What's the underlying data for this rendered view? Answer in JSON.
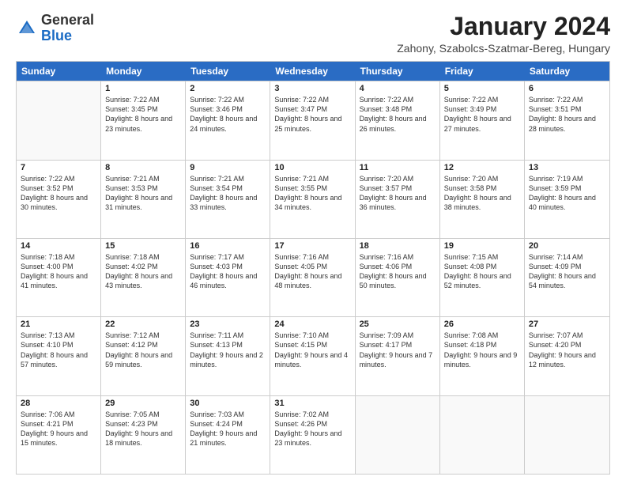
{
  "header": {
    "logo_general": "General",
    "logo_blue": "Blue",
    "month_title": "January 2024",
    "location": "Zahony, Szabolcs-Szatmar-Bereg, Hungary"
  },
  "weekdays": [
    "Sunday",
    "Monday",
    "Tuesday",
    "Wednesday",
    "Thursday",
    "Friday",
    "Saturday"
  ],
  "weeks": [
    [
      {
        "day": "",
        "sunrise": "",
        "sunset": "",
        "daylight": ""
      },
      {
        "day": "1",
        "sunrise": "Sunrise: 7:22 AM",
        "sunset": "Sunset: 3:45 PM",
        "daylight": "Daylight: 8 hours and 23 minutes."
      },
      {
        "day": "2",
        "sunrise": "Sunrise: 7:22 AM",
        "sunset": "Sunset: 3:46 PM",
        "daylight": "Daylight: 8 hours and 24 minutes."
      },
      {
        "day": "3",
        "sunrise": "Sunrise: 7:22 AM",
        "sunset": "Sunset: 3:47 PM",
        "daylight": "Daylight: 8 hours and 25 minutes."
      },
      {
        "day": "4",
        "sunrise": "Sunrise: 7:22 AM",
        "sunset": "Sunset: 3:48 PM",
        "daylight": "Daylight: 8 hours and 26 minutes."
      },
      {
        "day": "5",
        "sunrise": "Sunrise: 7:22 AM",
        "sunset": "Sunset: 3:49 PM",
        "daylight": "Daylight: 8 hours and 27 minutes."
      },
      {
        "day": "6",
        "sunrise": "Sunrise: 7:22 AM",
        "sunset": "Sunset: 3:51 PM",
        "daylight": "Daylight: 8 hours and 28 minutes."
      }
    ],
    [
      {
        "day": "7",
        "sunrise": "Sunrise: 7:22 AM",
        "sunset": "Sunset: 3:52 PM",
        "daylight": "Daylight: 8 hours and 30 minutes."
      },
      {
        "day": "8",
        "sunrise": "Sunrise: 7:21 AM",
        "sunset": "Sunset: 3:53 PM",
        "daylight": "Daylight: 8 hours and 31 minutes."
      },
      {
        "day": "9",
        "sunrise": "Sunrise: 7:21 AM",
        "sunset": "Sunset: 3:54 PM",
        "daylight": "Daylight: 8 hours and 33 minutes."
      },
      {
        "day": "10",
        "sunrise": "Sunrise: 7:21 AM",
        "sunset": "Sunset: 3:55 PM",
        "daylight": "Daylight: 8 hours and 34 minutes."
      },
      {
        "day": "11",
        "sunrise": "Sunrise: 7:20 AM",
        "sunset": "Sunset: 3:57 PM",
        "daylight": "Daylight: 8 hours and 36 minutes."
      },
      {
        "day": "12",
        "sunrise": "Sunrise: 7:20 AM",
        "sunset": "Sunset: 3:58 PM",
        "daylight": "Daylight: 8 hours and 38 minutes."
      },
      {
        "day": "13",
        "sunrise": "Sunrise: 7:19 AM",
        "sunset": "Sunset: 3:59 PM",
        "daylight": "Daylight: 8 hours and 40 minutes."
      }
    ],
    [
      {
        "day": "14",
        "sunrise": "Sunrise: 7:18 AM",
        "sunset": "Sunset: 4:00 PM",
        "daylight": "Daylight: 8 hours and 41 minutes."
      },
      {
        "day": "15",
        "sunrise": "Sunrise: 7:18 AM",
        "sunset": "Sunset: 4:02 PM",
        "daylight": "Daylight: 8 hours and 43 minutes."
      },
      {
        "day": "16",
        "sunrise": "Sunrise: 7:17 AM",
        "sunset": "Sunset: 4:03 PM",
        "daylight": "Daylight: 8 hours and 46 minutes."
      },
      {
        "day": "17",
        "sunrise": "Sunrise: 7:16 AM",
        "sunset": "Sunset: 4:05 PM",
        "daylight": "Daylight: 8 hours and 48 minutes."
      },
      {
        "day": "18",
        "sunrise": "Sunrise: 7:16 AM",
        "sunset": "Sunset: 4:06 PM",
        "daylight": "Daylight: 8 hours and 50 minutes."
      },
      {
        "day": "19",
        "sunrise": "Sunrise: 7:15 AM",
        "sunset": "Sunset: 4:08 PM",
        "daylight": "Daylight: 8 hours and 52 minutes."
      },
      {
        "day": "20",
        "sunrise": "Sunrise: 7:14 AM",
        "sunset": "Sunset: 4:09 PM",
        "daylight": "Daylight: 8 hours and 54 minutes."
      }
    ],
    [
      {
        "day": "21",
        "sunrise": "Sunrise: 7:13 AM",
        "sunset": "Sunset: 4:10 PM",
        "daylight": "Daylight: 8 hours and 57 minutes."
      },
      {
        "day": "22",
        "sunrise": "Sunrise: 7:12 AM",
        "sunset": "Sunset: 4:12 PM",
        "daylight": "Daylight: 8 hours and 59 minutes."
      },
      {
        "day": "23",
        "sunrise": "Sunrise: 7:11 AM",
        "sunset": "Sunset: 4:13 PM",
        "daylight": "Daylight: 9 hours and 2 minutes."
      },
      {
        "day": "24",
        "sunrise": "Sunrise: 7:10 AM",
        "sunset": "Sunset: 4:15 PM",
        "daylight": "Daylight: 9 hours and 4 minutes."
      },
      {
        "day": "25",
        "sunrise": "Sunrise: 7:09 AM",
        "sunset": "Sunset: 4:17 PM",
        "daylight": "Daylight: 9 hours and 7 minutes."
      },
      {
        "day": "26",
        "sunrise": "Sunrise: 7:08 AM",
        "sunset": "Sunset: 4:18 PM",
        "daylight": "Daylight: 9 hours and 9 minutes."
      },
      {
        "day": "27",
        "sunrise": "Sunrise: 7:07 AM",
        "sunset": "Sunset: 4:20 PM",
        "daylight": "Daylight: 9 hours and 12 minutes."
      }
    ],
    [
      {
        "day": "28",
        "sunrise": "Sunrise: 7:06 AM",
        "sunset": "Sunset: 4:21 PM",
        "daylight": "Daylight: 9 hours and 15 minutes."
      },
      {
        "day": "29",
        "sunrise": "Sunrise: 7:05 AM",
        "sunset": "Sunset: 4:23 PM",
        "daylight": "Daylight: 9 hours and 18 minutes."
      },
      {
        "day": "30",
        "sunrise": "Sunrise: 7:03 AM",
        "sunset": "Sunset: 4:24 PM",
        "daylight": "Daylight: 9 hours and 21 minutes."
      },
      {
        "day": "31",
        "sunrise": "Sunrise: 7:02 AM",
        "sunset": "Sunset: 4:26 PM",
        "daylight": "Daylight: 9 hours and 23 minutes."
      },
      {
        "day": "",
        "sunrise": "",
        "sunset": "",
        "daylight": ""
      },
      {
        "day": "",
        "sunrise": "",
        "sunset": "",
        "daylight": ""
      },
      {
        "day": "",
        "sunrise": "",
        "sunset": "",
        "daylight": ""
      }
    ]
  ]
}
